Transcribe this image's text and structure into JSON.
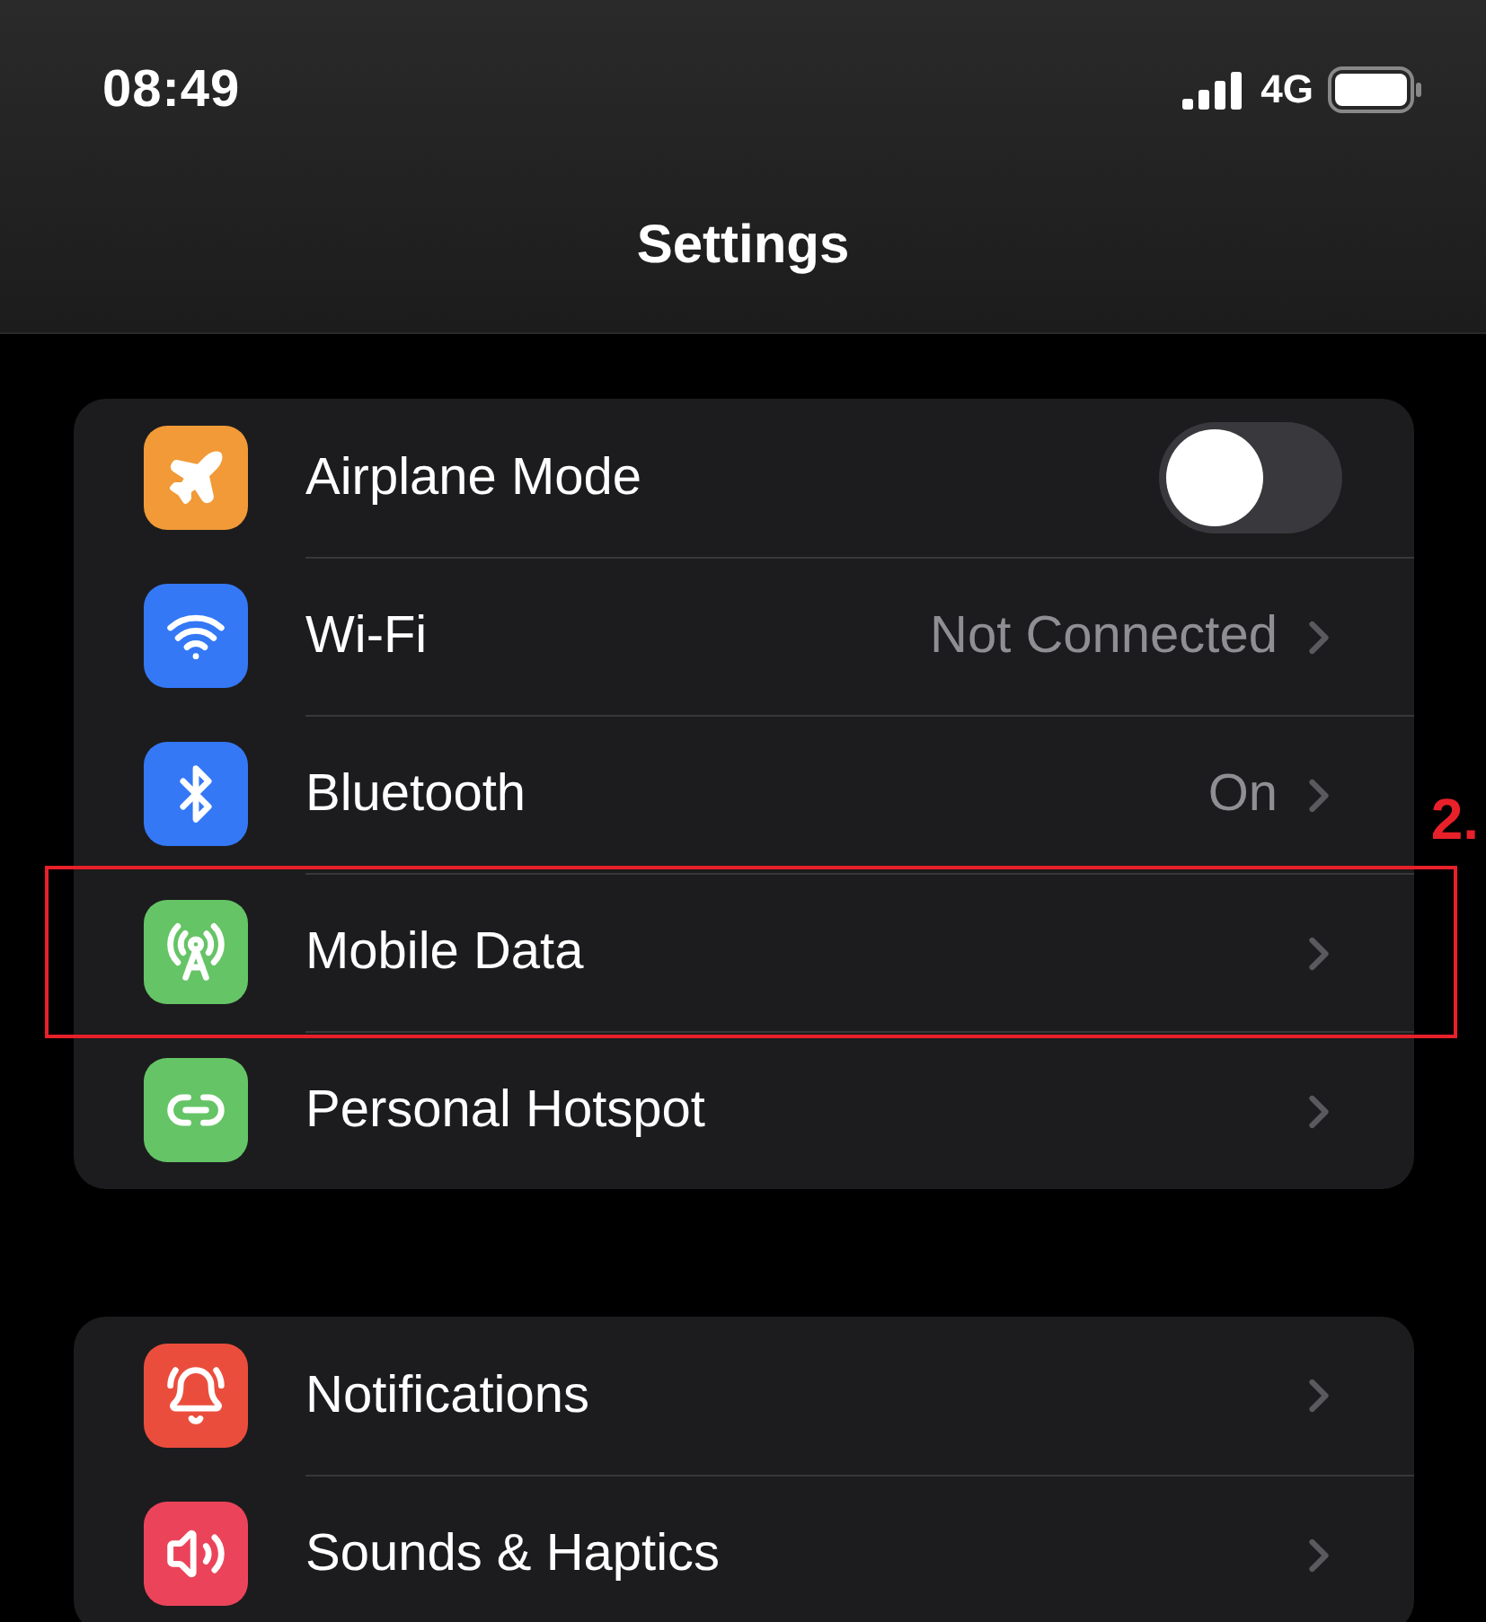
{
  "status_bar": {
    "time": "08:49",
    "network": "4G"
  },
  "header": {
    "title": "Settings"
  },
  "groups": [
    {
      "rows": [
        {
          "kind": "toggle",
          "label": "Airplane Mode",
          "on": false,
          "color": "#f19a37"
        },
        {
          "kind": "link",
          "label": "Wi-Fi",
          "value": "Not Connected",
          "color": "#3478f6"
        },
        {
          "kind": "link",
          "label": "Bluetooth",
          "value": "On",
          "color": "#3478f6"
        },
        {
          "kind": "link",
          "label": "Mobile Data",
          "color": "#65c466",
          "annotation": {
            "label": "2."
          }
        },
        {
          "kind": "link",
          "label": "Personal Hotspot",
          "color": "#65c466"
        }
      ]
    },
    {
      "rows": [
        {
          "kind": "link",
          "label": "Notifications",
          "color": "#eb4d3d"
        },
        {
          "kind": "link",
          "label": "Sounds & Haptics",
          "color": "#eb445a"
        }
      ]
    }
  ]
}
